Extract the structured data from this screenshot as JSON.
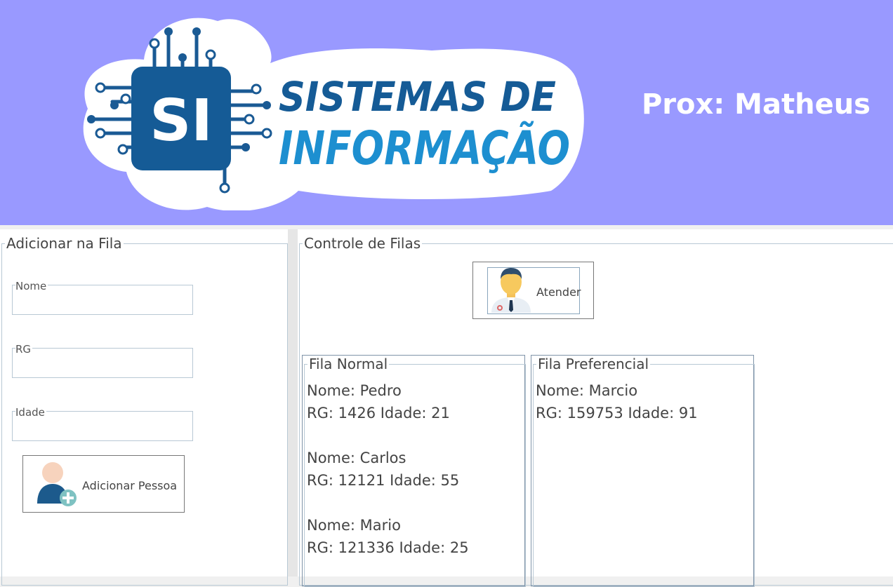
{
  "header": {
    "logo_line1": "SISTEMAS DE",
    "logo_line2": "INFORMAÇÃO",
    "logo_badge": "SI",
    "next_label": "Prox: Matheus",
    "bg_color": "#9999ff"
  },
  "add_panel": {
    "title": "Adicionar na Fila",
    "fields": {
      "nome": {
        "label": "Nome",
        "value": ""
      },
      "rg": {
        "label": "RG",
        "value": ""
      },
      "idade": {
        "label": "Idade",
        "value": ""
      }
    },
    "add_button": {
      "label": "Adicionar Pessoa",
      "icon": "add-person-icon"
    }
  },
  "control_panel": {
    "title": "Controle de Filas",
    "attend_button": {
      "label": "Atender",
      "icon": "doctor-icon"
    },
    "normal_queue": {
      "title": "Fila Normal",
      "entries": [
        {
          "name": "Nome: Pedro",
          "details": "RG: 1426 Idade: 21"
        },
        {
          "name": "Nome: Carlos",
          "details": "RG: 12121 Idade: 55"
        },
        {
          "name": "Nome: Mario",
          "details": "RG: 121336 Idade: 25"
        }
      ]
    },
    "priority_queue": {
      "title": "Fila Preferencial",
      "entries": [
        {
          "name": "Nome: Marcio",
          "details": "RG: 159753 Idade: 91"
        }
      ]
    }
  }
}
